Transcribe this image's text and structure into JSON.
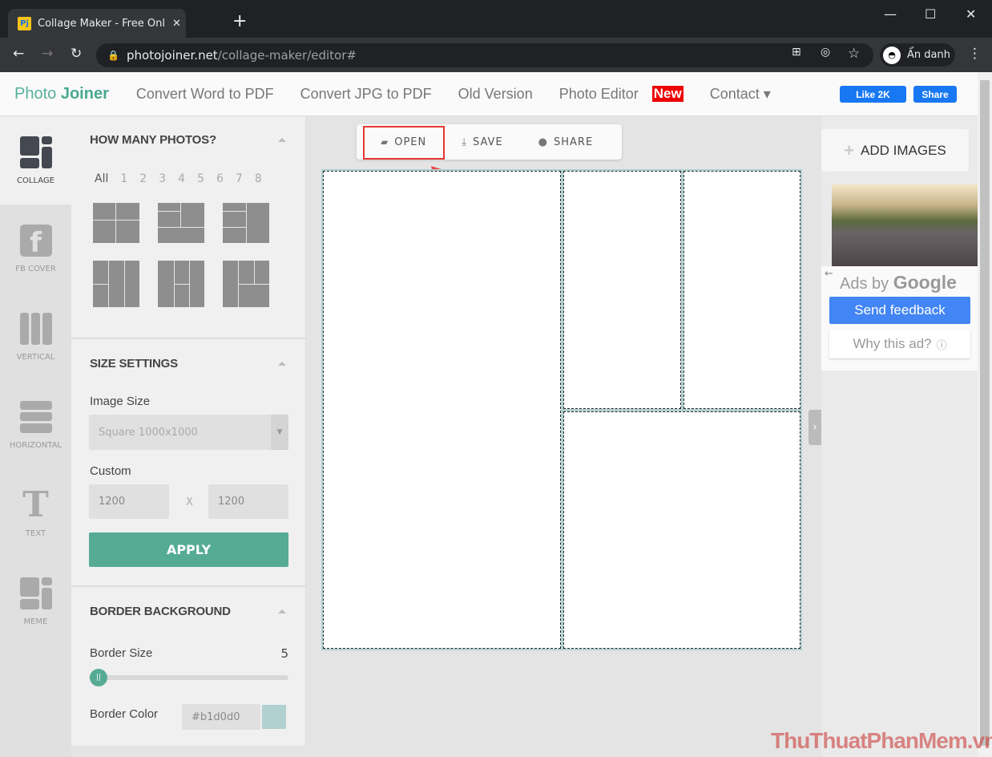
{
  "browser": {
    "tab_title": "Collage Maker - Free Online Phot",
    "favicon": "Pj",
    "url_host": "photojoiner.net",
    "url_path": "/collage-maker/editor#",
    "profile": "Ẩn danh"
  },
  "nav": {
    "logo_a": "Photo",
    "logo_b": "Joiner",
    "links": [
      "Convert Word to PDF",
      "Convert JPG to PDF",
      "Old Version",
      "Photo Editor"
    ],
    "new_badge": "New",
    "contact": "Contact ▾",
    "like": "Like 2K",
    "share": "Share"
  },
  "rail": [
    {
      "label": "COLLAGE",
      "icon": "collage-icon"
    },
    {
      "label": "FB COVER",
      "icon": "facebook-icon"
    },
    {
      "label": "VERTICAL",
      "icon": "vertical-icon"
    },
    {
      "label": "HORIZONTAL",
      "icon": "horizontal-icon"
    },
    {
      "label": "TEXT",
      "icon": "text-icon"
    },
    {
      "label": "MEME",
      "icon": "meme-icon"
    }
  ],
  "panel": {
    "how_many": "HOW MANY PHOTOS?",
    "counts": [
      "All",
      "1",
      "2",
      "3",
      "4",
      "5",
      "6",
      "7",
      "8"
    ],
    "size_settings": "SIZE SETTINGS",
    "image_size_label": "Image Size",
    "image_size_value": "Square 1000x1000",
    "custom_label": "Custom",
    "width": "1200",
    "x": "X",
    "height": "1200",
    "apply": "APPLY",
    "border_bg": "BORDER BACKGROUND",
    "border_size_label": "Border Size",
    "border_size": "5",
    "border_color_label": "Border Color",
    "border_color": "#b1d0d0"
  },
  "toolbar": {
    "open": "OPEN",
    "save": "SAVE",
    "share": "SHARE"
  },
  "right": {
    "add_images": "ADD IMAGES",
    "ads_by": "Ads by",
    "google": "Google",
    "send_feedback": "Send feedback",
    "why": "Why this ad?"
  },
  "colors": {
    "accent": "#55ab94",
    "highlight": "#e53935"
  },
  "watermark": "ThuThuatPhanMem.vn"
}
